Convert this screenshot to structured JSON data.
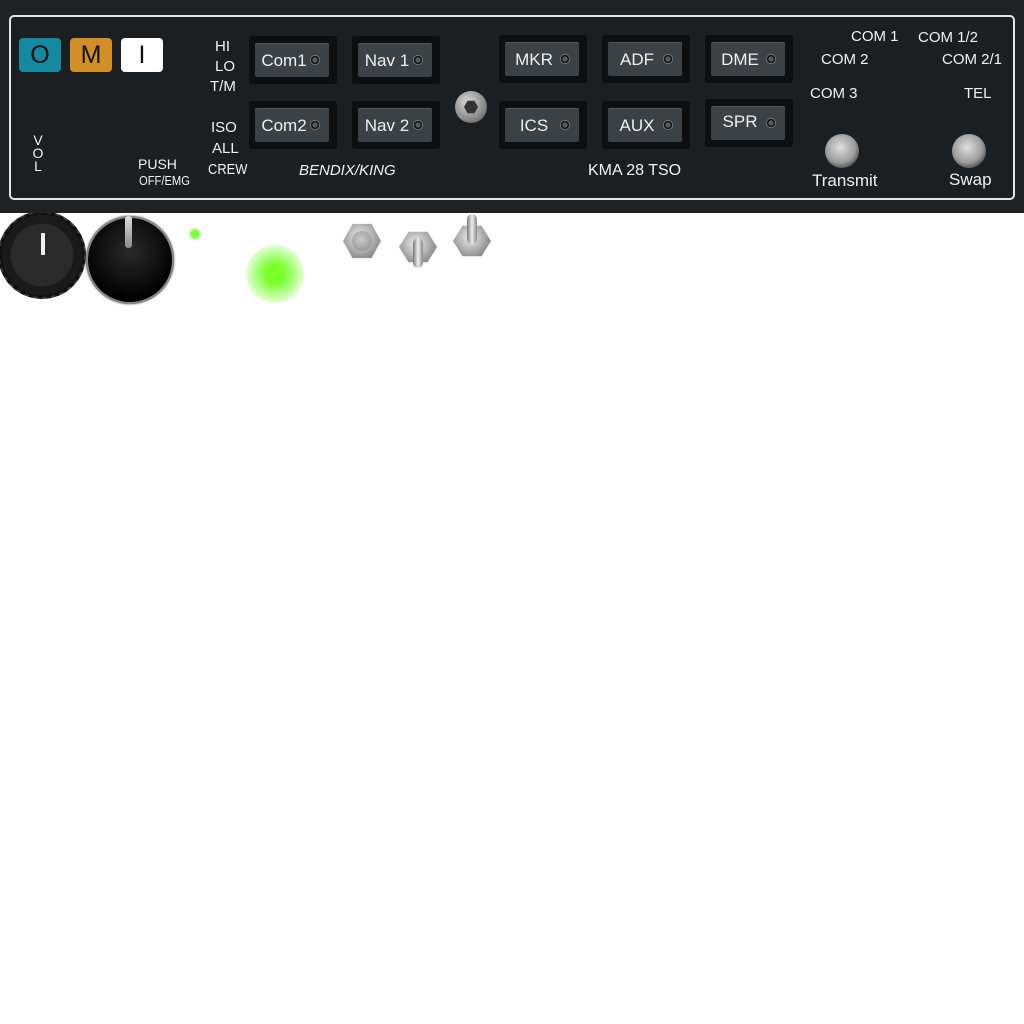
{
  "markers": {
    "outer": {
      "label": "O",
      "color": "#1589a0"
    },
    "middle": {
      "label": "M",
      "color": "#d18f26"
    },
    "inner": {
      "label": "I",
      "color": "#ffffff"
    }
  },
  "vol_label": "V O L",
  "push_label": "PUSH",
  "off_emg_label": "OFF/EMG",
  "mkr_sens": [
    "HI",
    "LO",
    "T/M"
  ],
  "isolation": [
    "ISO",
    "ALL",
    "CREW"
  ],
  "brand": "BENDIX/KING",
  "model": "KMA 28 TSO",
  "audio_buttons": {
    "com1": "Com1",
    "nav1": "Nav 1",
    "mkr": "MKR",
    "adf": "ADF",
    "dme": "DME",
    "com2": "Com2",
    "nav2": "Nav 2",
    "ics": "ICS",
    "aux": "AUX",
    "spr": "SPR"
  },
  "mic_selector": {
    "com1": "COM 1",
    "com12": "COM 1/2",
    "com2": "COM 2",
    "com21": "COM 2/1",
    "com3": "COM 3",
    "tel": "TEL"
  },
  "transmit_label": "Transmit",
  "swap_label": "Swap",
  "indicators": {
    "mkr_led_color": "#7aff3a",
    "status_led_color": "#7aff2a"
  }
}
